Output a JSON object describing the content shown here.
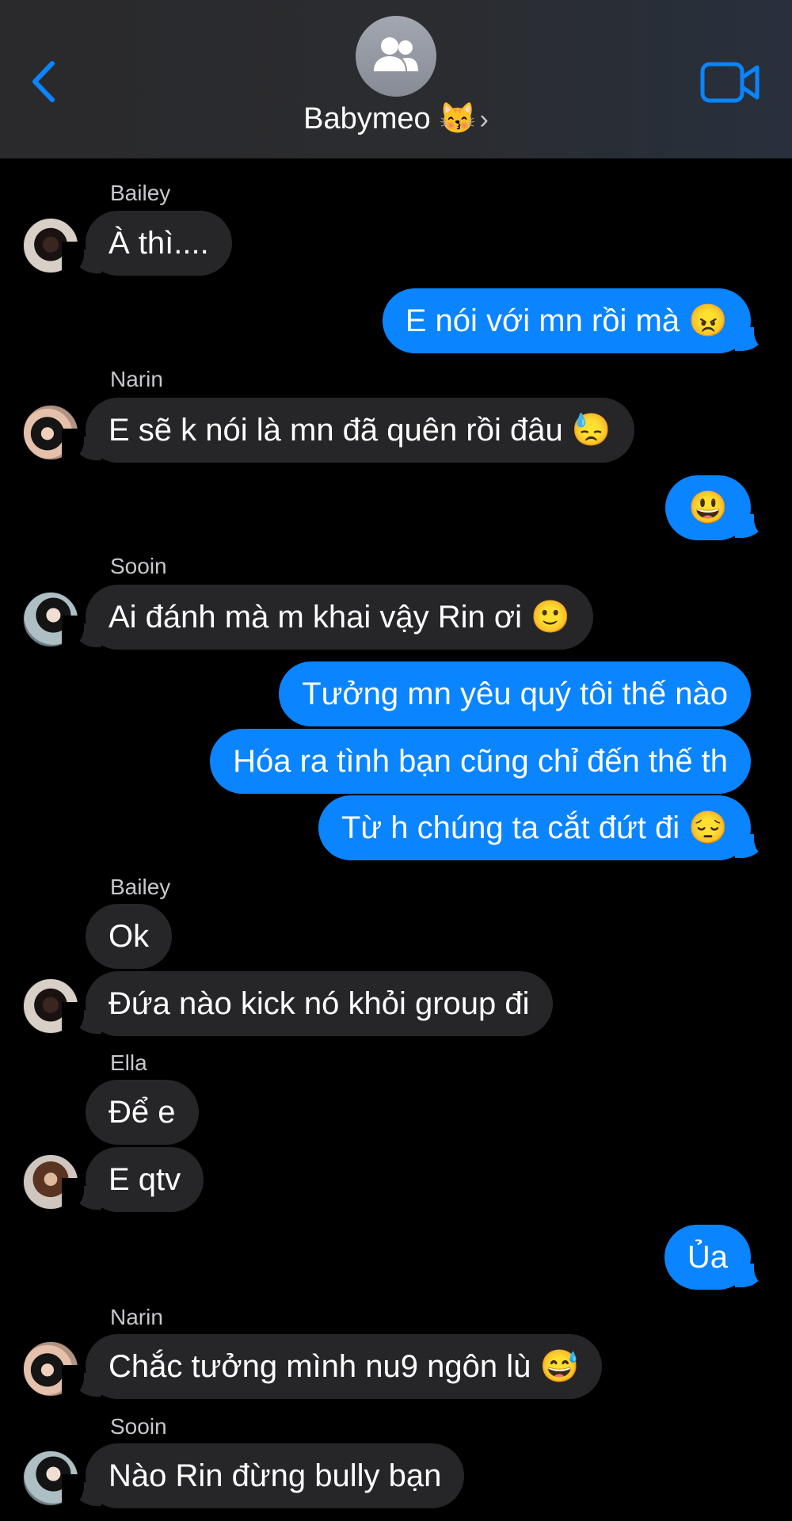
{
  "header": {
    "title": "Babymeo 😽",
    "chevron": "›",
    "icons": {
      "back": "chevron-left-icon",
      "video": "video-camera-icon",
      "group": "group-people-icon"
    },
    "accent_color": "#0a84ff"
  },
  "senders": {
    "bailey_1": "Bailey",
    "narin_1": "Narin",
    "sooin_1": "Sooin",
    "bailey_2": "Bailey",
    "ella_1": "Ella",
    "narin_2": "Narin",
    "sooin_2": "Sooin"
  },
  "messages": {
    "m1": "À thì....",
    "m2": "E nói với mn rồi mà 😠",
    "m3": "E sẽ k nói là mn đã quên rồi đâu 😓",
    "m4": "😃",
    "m5": "Ai đánh mà m khai vậy Rin ơi 🙂",
    "m6": "Tưởng mn yêu quý tôi thế nào",
    "m7": "Hóa ra tình bạn cũng chỉ đến thế th",
    "m8": "Từ h chúng ta cắt đứt đi 😔",
    "m9": "Ok",
    "m10": "Đứa nào kick nó khỏi group đi",
    "m11": "Để e",
    "m12": "E qtv",
    "m13": "Ủa",
    "m14": "Chắc tưởng mình nu9 ngôn lù 😅",
    "m15": "Nào Rin đừng bully bạn"
  },
  "colors": {
    "background": "#000000",
    "incoming_bubble": "#262629",
    "outgoing_bubble": "#0a84ff",
    "sender_name": "#c7c7cc"
  }
}
